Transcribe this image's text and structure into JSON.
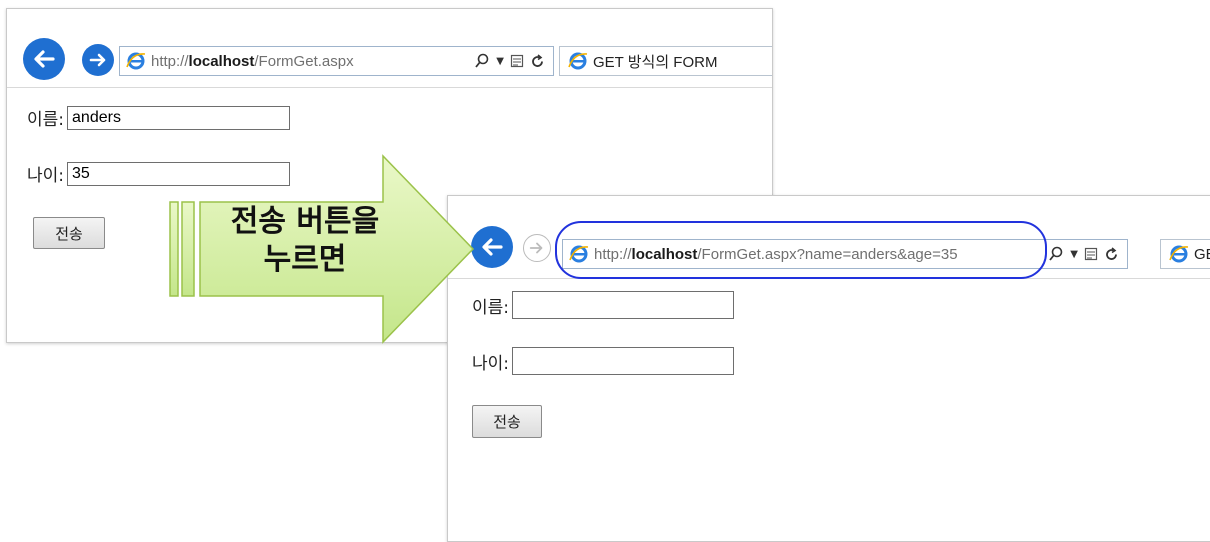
{
  "window_before": {
    "url_host": "http://",
    "url_bold": "localhost",
    "url_path": "/FormGet.aspx",
    "tab_title": "GET 방식의 FORM",
    "form": {
      "name_label": "이름:",
      "name_value": "anders",
      "age_label": "나이:",
      "age_value": "35",
      "submit_label": "전송"
    }
  },
  "window_after": {
    "url_host": "http://",
    "url_bold": "localhost",
    "url_path": "/FormGet.aspx?name=anders&age=35",
    "tab_title": "GE",
    "form": {
      "name_label": "이름:",
      "name_value": "",
      "age_label": "나이:",
      "age_value": "",
      "submit_label": "전송"
    }
  },
  "callout": {
    "line1": "전송 버튼을",
    "line2": "누르면"
  },
  "colors": {
    "ie_blue": "#1f6fd1",
    "highlight": "#2233dd",
    "callout_fill": "#d7f0a8",
    "callout_border": "#9bc24a"
  },
  "icons": [
    "back-arrow-icon",
    "forward-arrow-icon",
    "ie-logo-icon",
    "search-icon",
    "dropdown-icon",
    "compat-view-icon",
    "refresh-icon"
  ]
}
